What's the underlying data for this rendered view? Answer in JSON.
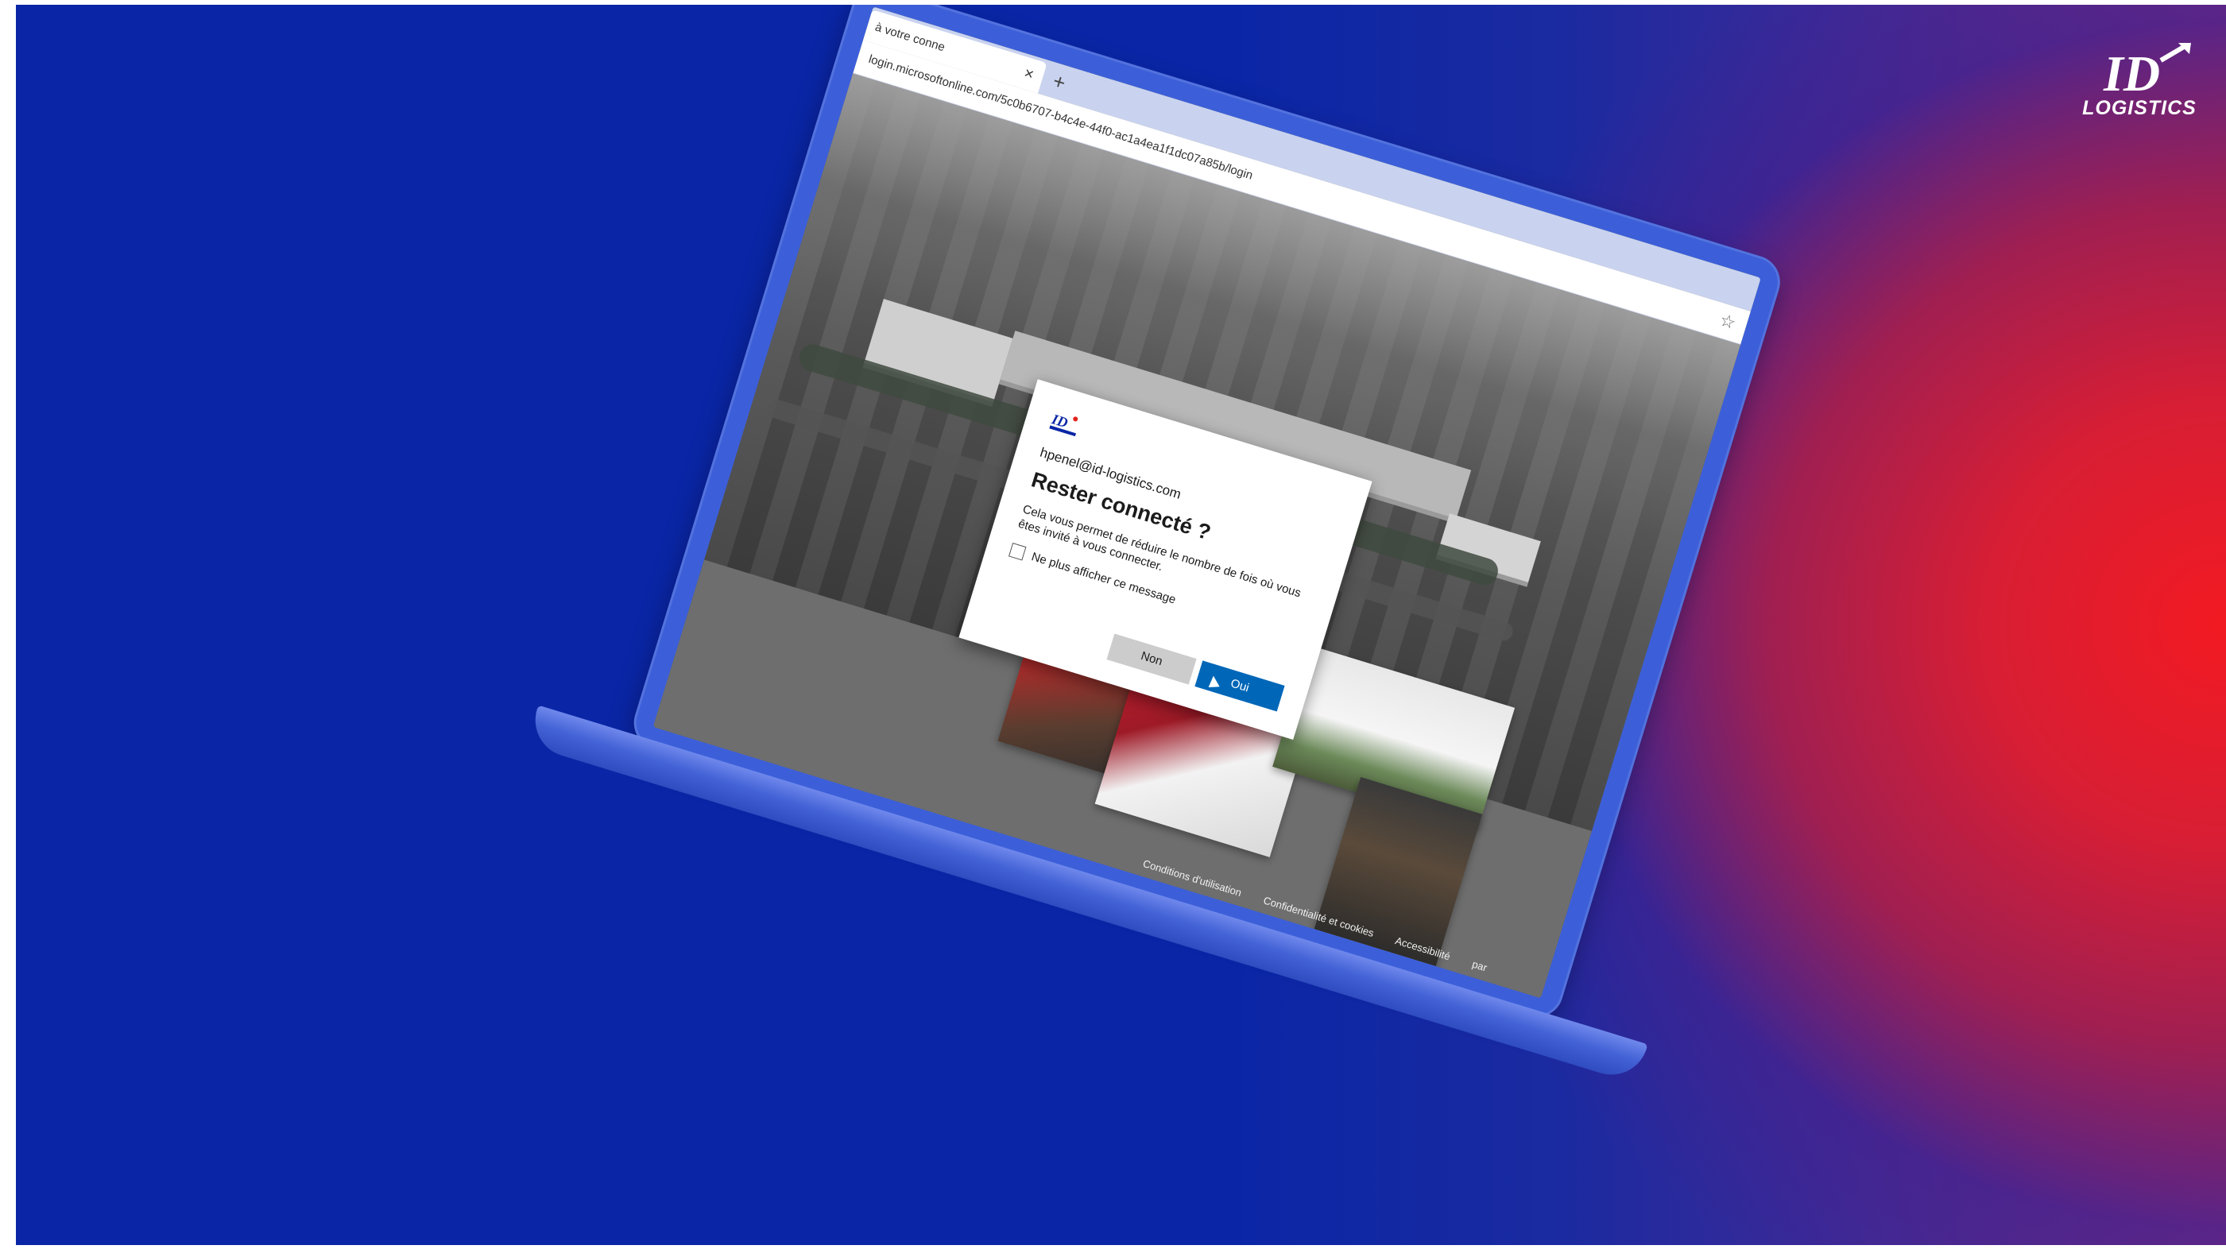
{
  "brand": {
    "logo_wordmark": "LOGISTICS",
    "logo_mark": "ID",
    "colors": {
      "blue": "#0a26a6",
      "red": "#f21a22",
      "white": "#ffffff"
    }
  },
  "browser": {
    "tab_title": "à votre conne",
    "tab_close": "×",
    "new_tab": "+",
    "url": "login.microsoftonline.com/5c0b6707-b4c4e-44f0-ac1a4ea1f1dc07a85b/login",
    "star": "☆"
  },
  "dialog": {
    "email": "hpenel@id-logistics.com",
    "title": "Rester connecté ?",
    "description": "Cela vous permet de réduire le nombre de fois où vous êtes invité à vous connecter.",
    "checkbox_label": "Ne plus afficher ce message",
    "checkbox_checked": false,
    "button_no": "Non",
    "button_yes": "Oui"
  },
  "footer": {
    "links": [
      "Conditions d'utilisation",
      "Confidentialité et cookies",
      "Accessibilité",
      "par"
    ]
  }
}
